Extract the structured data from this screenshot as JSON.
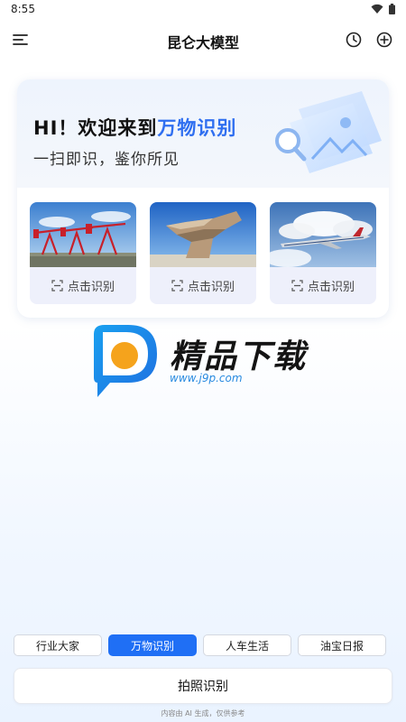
{
  "status": {
    "time": "8:55"
  },
  "app_bar": {
    "title": "昆仑大模型",
    "left_icon": "menu-icon",
    "right_icons": [
      "history-icon",
      "add-circle-icon"
    ]
  },
  "welcome": {
    "prefix": "HI！欢迎来到",
    "highlight": "万物识别",
    "subtitle": "一扫即识，鉴你所见",
    "accent_color": "#2f6ff0"
  },
  "samples": [
    {
      "image": "oil-pumpjacks",
      "action_label": "点击识别"
    },
    {
      "image": "rock-formation",
      "action_label": "点击识别"
    },
    {
      "image": "airplane",
      "action_label": "点击识别"
    }
  ],
  "watermark": {
    "text": "精品下载",
    "url": "www.j9p.com"
  },
  "mode_tabs": [
    {
      "label": "行业大家",
      "active": false
    },
    {
      "label": "万物识别",
      "active": true
    },
    {
      "label": "人车生活",
      "active": false
    },
    {
      "label": "油宝日报",
      "active": false
    }
  ],
  "capture_button": {
    "label": "拍照识别"
  },
  "disclaimer": "内容由 AI 生成，仅供参考",
  "colors": {
    "primary": "#1f6ff5",
    "card_bg": "#eef0fb"
  }
}
